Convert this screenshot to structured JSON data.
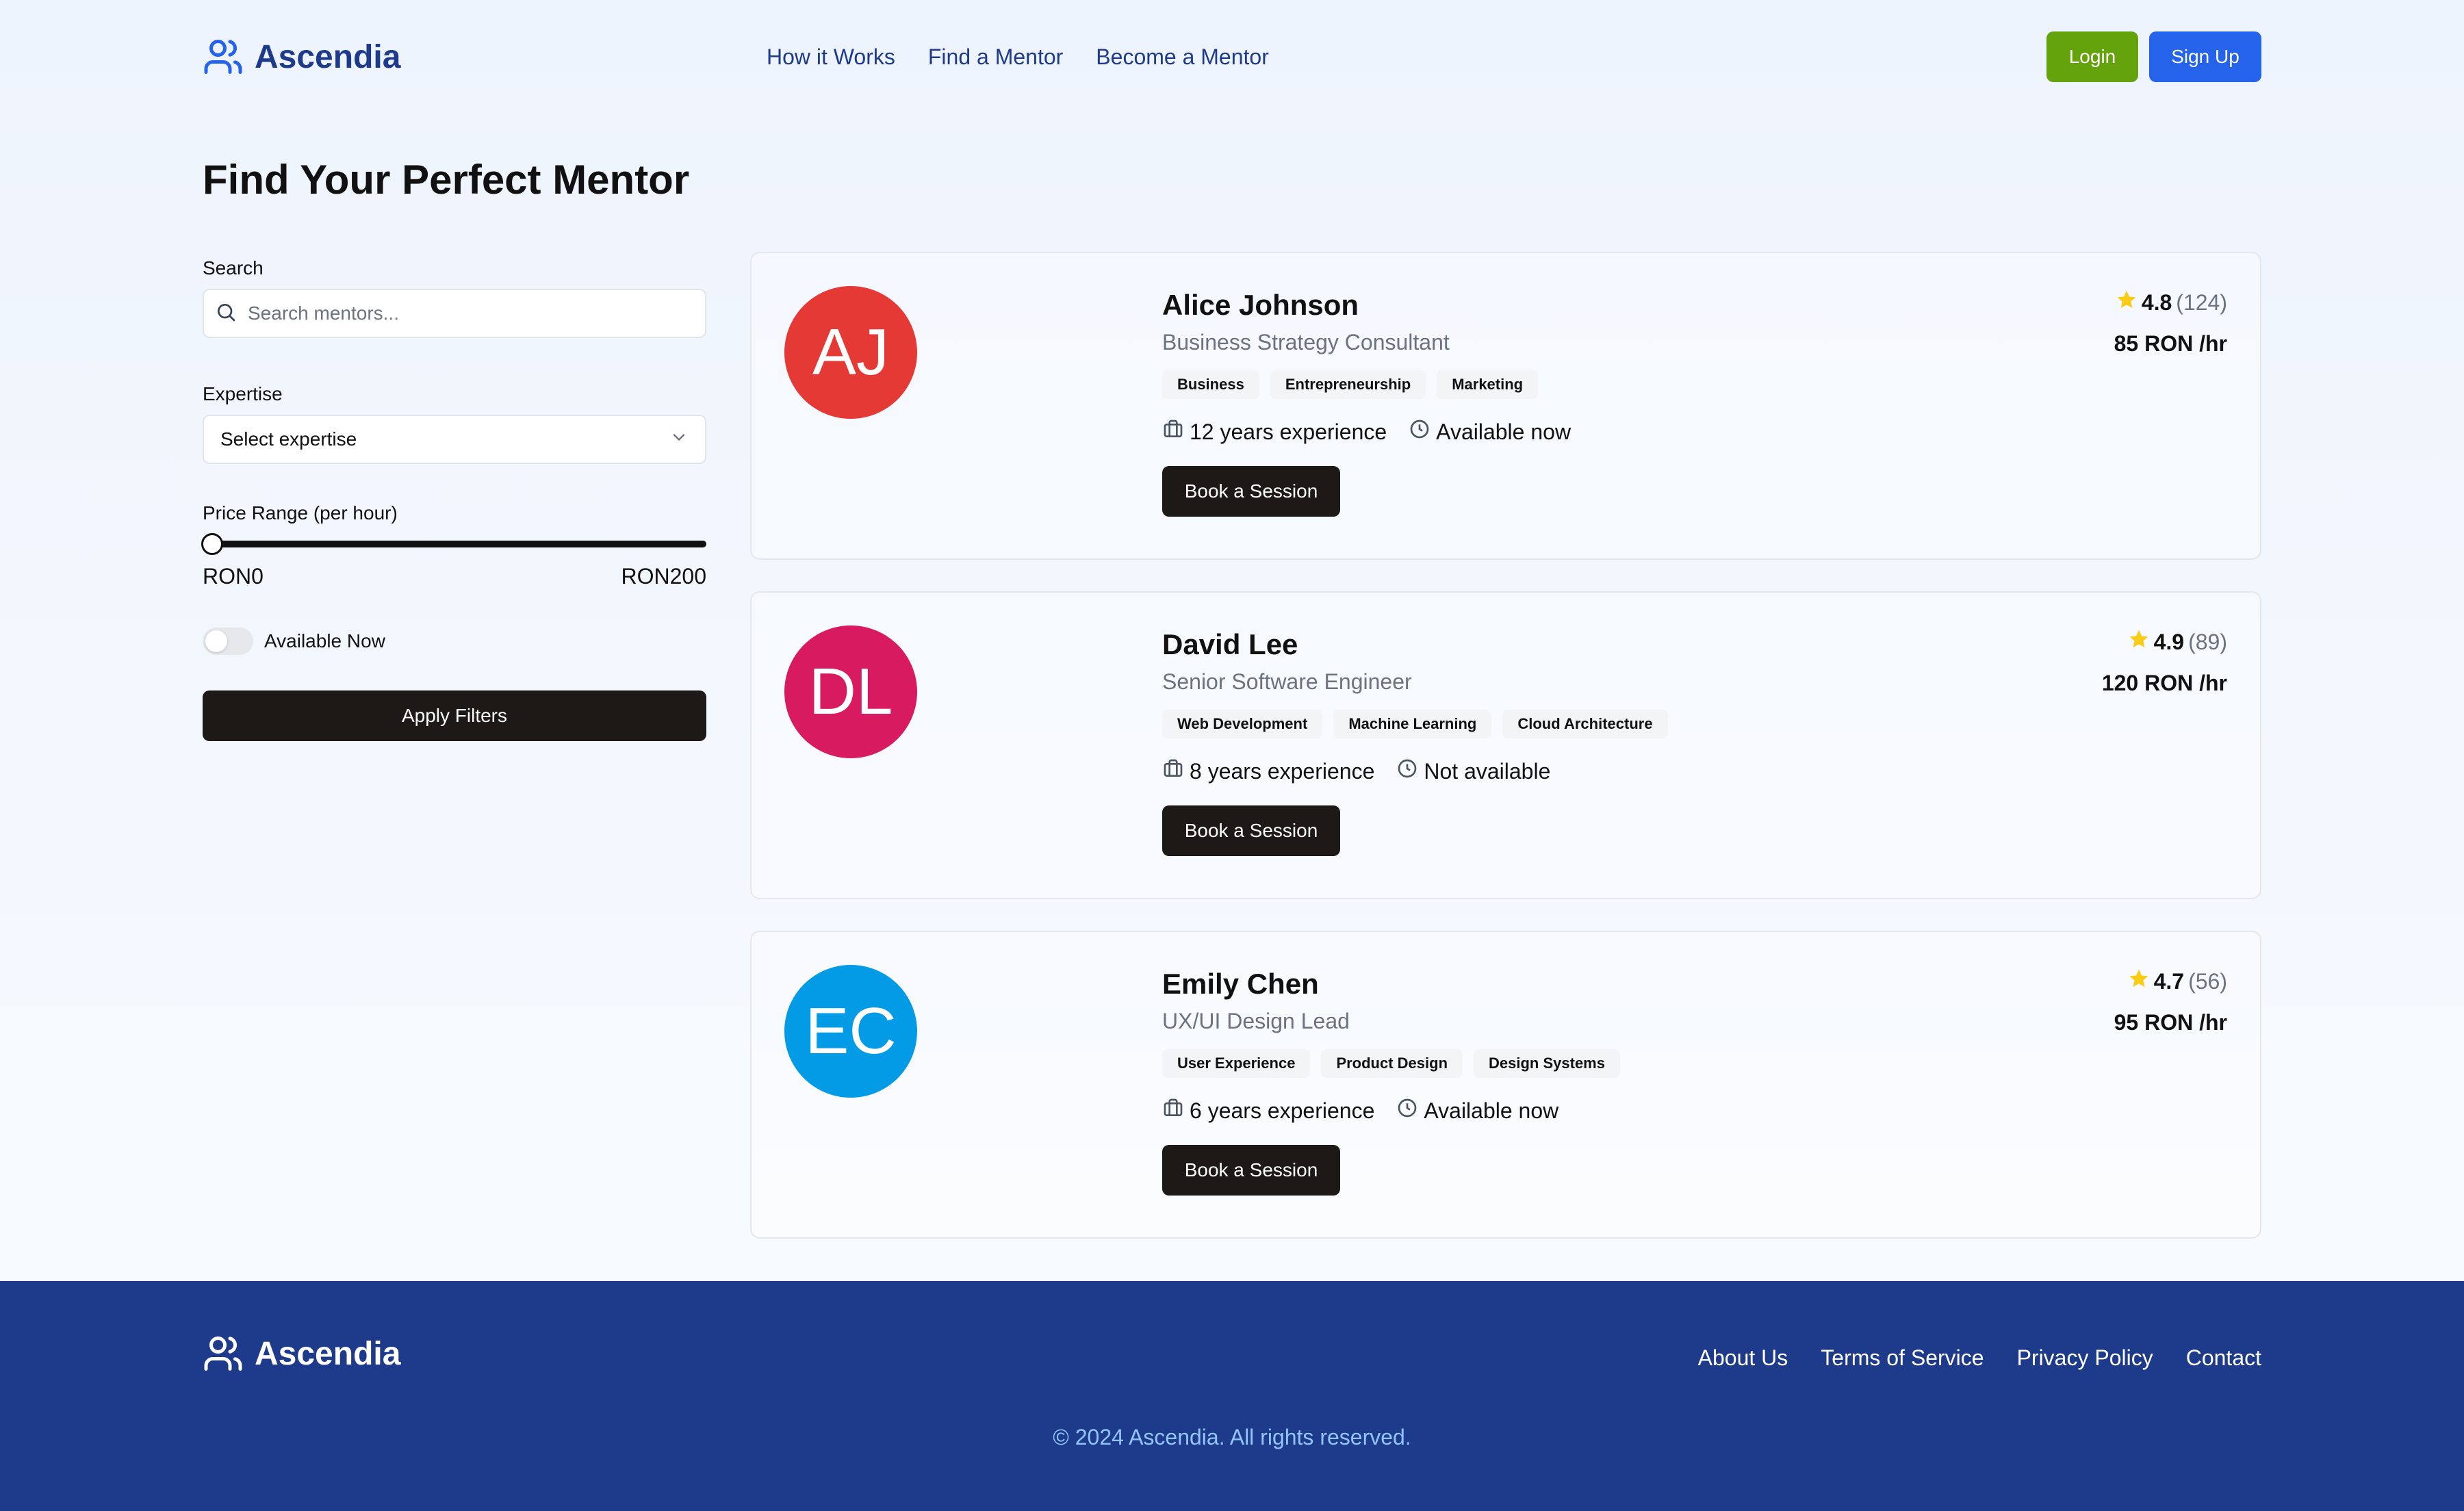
{
  "brand": {
    "name": "Ascendia",
    "icon": "users-icon",
    "color": "#1e3a8a"
  },
  "nav": {
    "items": [
      "How it Works",
      "Find a Mentor",
      "Become a Mentor"
    ]
  },
  "auth": {
    "login_label": "Login",
    "signup_label": "Sign Up",
    "login_color": "#65a30d",
    "signup_color": "#2563eb"
  },
  "page": {
    "title": "Find Your Perfect Mentor"
  },
  "filters": {
    "search_label": "Search",
    "search_placeholder": "Search mentors...",
    "expertise_label": "Expertise",
    "expertise_value": "Select expertise",
    "price_label": "Price Range (per hour)",
    "price_min": "RON0",
    "price_max": "RON200",
    "price_slider_value": 0,
    "available_label": "Available Now",
    "available_on": false,
    "apply_label": "Apply Filters"
  },
  "mentors": [
    {
      "initials": "AJ",
      "avatar_color": "#e53935",
      "name": "Alice Johnson",
      "role": "Business Strategy Consultant",
      "tags": [
        "Business",
        "Entrepreneurship",
        "Marketing"
      ],
      "experience": "12 years experience",
      "availability": "Available now",
      "rating": "4.8",
      "reviews": "(124)",
      "price": "85 RON /hr",
      "book_label": "Book a Session"
    },
    {
      "initials": "DL",
      "avatar_color": "#d81b60",
      "name": "David Lee",
      "role": "Senior Software Engineer",
      "tags": [
        "Web Development",
        "Machine Learning",
        "Cloud Architecture"
      ],
      "experience": "8 years experience",
      "availability": "Not available",
      "rating": "4.9",
      "reviews": "(89)",
      "price": "120 RON /hr",
      "book_label": "Book a Session"
    },
    {
      "initials": "EC",
      "avatar_color": "#039be5",
      "name": "Emily Chen",
      "role": "UX/UI Design Lead",
      "tags": [
        "User Experience",
        "Product Design",
        "Design Systems"
      ],
      "experience": "6 years experience",
      "availability": "Available now",
      "rating": "4.7",
      "reviews": "(56)",
      "price": "95 RON /hr",
      "book_label": "Book a Session"
    }
  ],
  "footer": {
    "brand": "Ascendia",
    "links": [
      "About Us",
      "Terms of Service",
      "Privacy Policy",
      "Contact"
    ],
    "copyright": "© 2024 Ascendia. All rights reserved.",
    "background": "#1e3a8a"
  }
}
